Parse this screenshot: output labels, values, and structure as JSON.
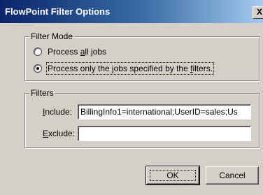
{
  "window": {
    "title": "FlowPoint Filter Options",
    "close_glyph": "X"
  },
  "filter_mode": {
    "legend": "Filter Mode",
    "options": [
      {
        "pre": "Process ",
        "access": "a",
        "post": "ll jobs",
        "selected": false
      },
      {
        "pre": "Process only the jobs specified by the ",
        "access": "f",
        "post": "ilters.",
        "selected": true
      }
    ]
  },
  "filters": {
    "legend": "Filters",
    "include_label_access": "I",
    "include_label_rest": "nclude:",
    "include_value": "BillingInfo1=international;UserID=sales;Us",
    "exclude_label_access": "E",
    "exclude_label_rest": "xclude:",
    "exclude_value": ""
  },
  "buttons": {
    "ok": "OK",
    "cancel": "Cancel"
  }
}
